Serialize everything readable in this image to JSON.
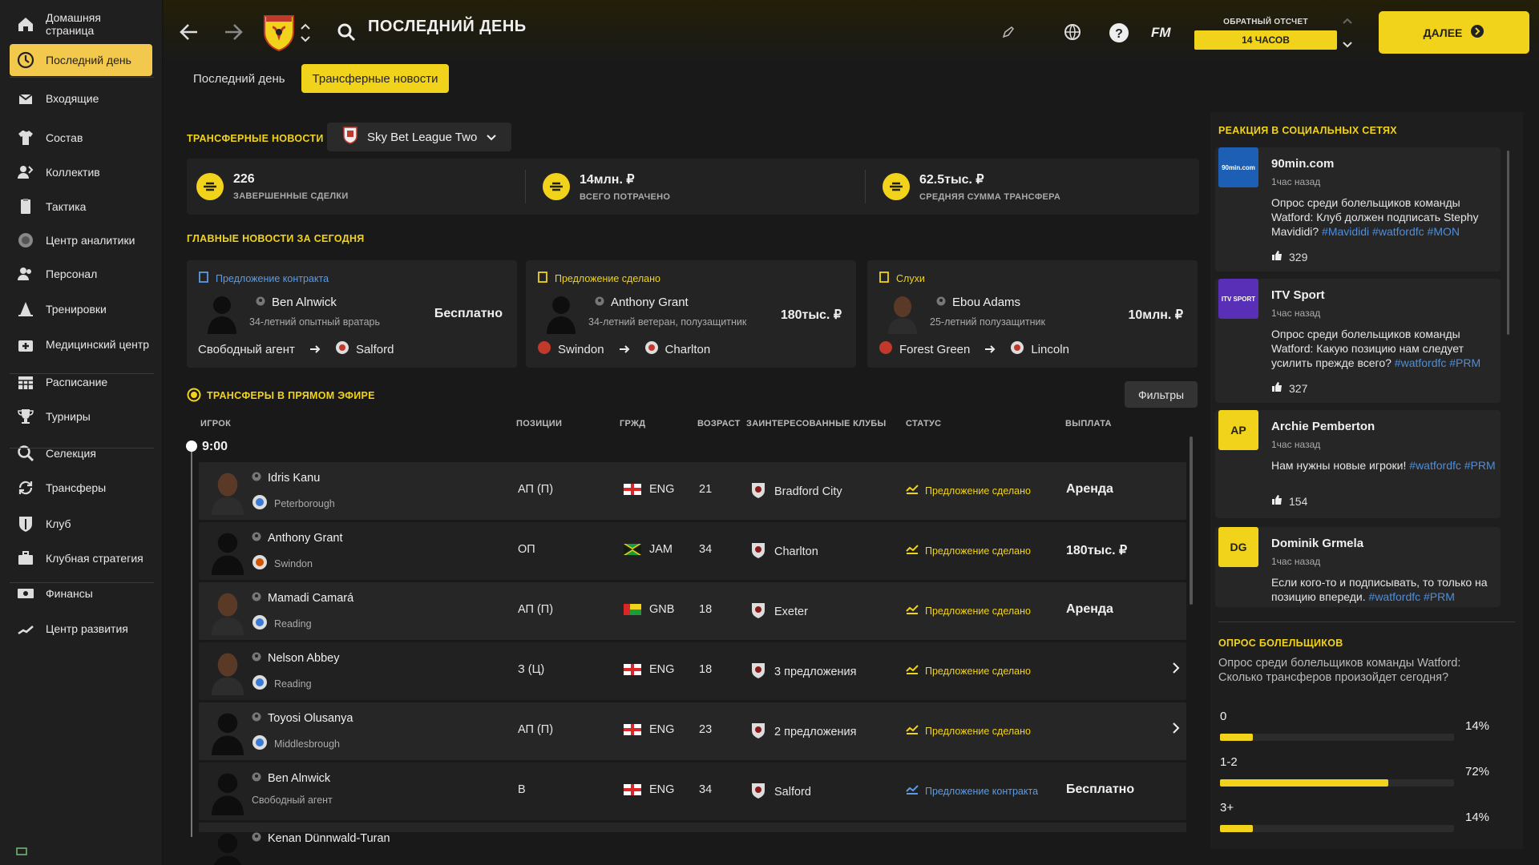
{
  "colors": {
    "accent": "#f2d31b",
    "sidebar_active": "#f2c94c",
    "link_blue": "#4a8fe0",
    "background": "#191919"
  },
  "sidebar": {
    "items": [
      {
        "label": "Домашняя страница",
        "icon": "home-icon"
      },
      {
        "label": "Последний день",
        "icon": "clock-icon",
        "active": true
      },
      {
        "label": "Входящие",
        "icon": "inbox-icon"
      },
      {
        "label": "Состав",
        "icon": "shirt-icon"
      },
      {
        "label": "Коллектив",
        "icon": "people-icon"
      },
      {
        "label": "Тактика",
        "icon": "tactics-board-icon"
      },
      {
        "label": "Центр аналитики",
        "icon": "analytics-icon"
      },
      {
        "label": "Персонал",
        "icon": "staff-icon"
      },
      {
        "label": "Тренировки",
        "icon": "cone-icon"
      },
      {
        "label": "Медицинский центр",
        "icon": "medical-kit-icon"
      },
      {
        "label": "Расписание",
        "icon": "calendar-icon"
      },
      {
        "label": "Турниры",
        "icon": "trophy-icon"
      },
      {
        "label": "Селекция",
        "icon": "magnifier-icon"
      },
      {
        "label": "Трансферы",
        "icon": "refresh-arrows-icon"
      },
      {
        "label": "Клуб",
        "icon": "shield-icon"
      },
      {
        "label": "Клубная стратегия",
        "icon": "briefcase-icon"
      },
      {
        "label": "Финансы",
        "icon": "money-icon"
      },
      {
        "label": "Центр развития",
        "icon": "growth-icon"
      }
    ]
  },
  "header": {
    "title": "ПОСЛЕДНИЙ ДЕНЬ",
    "club": "WATFORD",
    "fm_label": "FM",
    "countdown_label": "ОБРАТНЫЙ ОТСЧЕТ",
    "countdown_value": "14 ЧАСОВ",
    "next_label": "ДАЛЕЕ"
  },
  "tabs": [
    {
      "label": "Последний день"
    },
    {
      "label": "Трансферные новости",
      "active": true
    }
  ],
  "transfer_news": {
    "title": "ТРАНСФЕРНЫЕ НОВОСТИ",
    "league": "Sky Bet League Two"
  },
  "stats": [
    {
      "value": "226",
      "caption": "ЗАВЕРШЕННЫЕ СДЕЛКИ"
    },
    {
      "value": "14млн. ₽",
      "caption": "ВСЕГО ПОТРАЧЕНО"
    },
    {
      "value": "62.5тыс. ₽",
      "caption": "СРЕДНЯЯ СУММА ТРАНСФЕРА"
    }
  ],
  "top_news": {
    "title": "ГЛАВНЫЕ НОВОСТИ ЗА СЕГОДНЯ",
    "cards": [
      {
        "type": "Предложение контракта",
        "type_color": "#5b9be6",
        "name": "Ben Alnwick",
        "desc": "34-летний опытный вратарь",
        "fee": "Бесплатно",
        "from": "Свободный агент",
        "to": "Salford"
      },
      {
        "type": "Предложение сделано",
        "type_color": "#f2d31b",
        "name": "Anthony Grant",
        "desc": "34-летний ветеран, полузащитник",
        "fee": "180тыс. ₽",
        "from": "Swindon",
        "to": "Charlton"
      },
      {
        "type": "Слухи",
        "type_color": "#f2d31b",
        "name": "Ebou Adams",
        "desc": "25-летний полузащитник",
        "fee": "10млн. ₽",
        "from": "Forest Green",
        "to": "Lincoln"
      }
    ]
  },
  "live": {
    "title": "ТРАНСФЕРЫ В ПРЯМОМ ЭФИРЕ",
    "filters_label": "Фильтры",
    "time": "9:00",
    "columns": {
      "player": "ИГРОК",
      "position": "ПОЗИЦИИ",
      "nat": "ГРЖД",
      "age": "ВОЗРАСТ",
      "clubs": "ЗАИНТЕРЕСОВАННЫЕ КЛУБЫ",
      "status": "СТАТУС",
      "fee": "ВЫПЛАТА"
    },
    "rows": [
      {
        "name": "Idris Kanu",
        "club": "Peterborough",
        "position": "АП (П)",
        "nat": "ENG",
        "age": "21",
        "interested": "Bradford City",
        "status": "Предложение сделано",
        "fee": "Аренда"
      },
      {
        "name": "Anthony Grant",
        "club": "Swindon",
        "position": "ОП",
        "nat": "JAM",
        "age": "34",
        "interested": "Charlton",
        "status": "Предложение сделано",
        "fee": "180тыс. ₽"
      },
      {
        "name": "Mamadi Camará",
        "club": "Reading",
        "position": "АП (П)",
        "nat": "GNB",
        "age": "18",
        "interested": "Exeter",
        "status": "Предложение сделано",
        "fee": "Аренда"
      },
      {
        "name": "Nelson Abbey",
        "club": "Reading",
        "position": "З (Ц)",
        "nat": "ENG",
        "age": "18",
        "interested": "3 предложения",
        "status": "Предложение сделано",
        "fee": ""
      },
      {
        "name": "Toyosi Olusanya",
        "club": "Middlesbrough",
        "position": "АП (П)",
        "nat": "ENG",
        "age": "23",
        "interested": "2 предложения",
        "status": "Предложение сделано",
        "fee": ""
      },
      {
        "name": "Ben Alnwick",
        "club": "Свободный агент",
        "position": "В",
        "nat": "ENG",
        "age": "34",
        "interested": "Salford",
        "status": "Предложение контракта",
        "fee": "Бесплатно"
      },
      {
        "name": "Kenan Dünnwald-Turan",
        "club": "",
        "position": "",
        "nat": "",
        "age": "",
        "interested": "",
        "status": "",
        "fee": ""
      }
    ]
  },
  "social": {
    "title": "РЕАКЦИЯ В СОЦИАЛЬНЫХ СЕТЯХ",
    "posts": [
      {
        "avatar": "90min.com",
        "name": "90min.com",
        "time": "1час назад",
        "text": "Опрос среди болельщиков команды Watford: Клуб должен подписать Stephy Mavididi?",
        "tags": "#Mavididi #watfordfc #MON",
        "likes": "329"
      },
      {
        "avatar": "ITV SPORT",
        "name": "ITV Sport",
        "time": "1час назад",
        "text": "Опрос среди болельщиков команды Watford: Какую позицию нам следует усилить прежде всего?",
        "tags": "#watfordfc #PRM",
        "likes": "327"
      },
      {
        "avatar": "AP",
        "name": "Archie Pemberton",
        "time": "1час назад",
        "text": "Нам нужны новые игроки!",
        "tags": "#watfordfc #PRM",
        "likes": "154"
      },
      {
        "avatar": "DG",
        "name": "Dominik Grmela",
        "time": "1час назад",
        "text": "Если кого-то и подписывать, то только на позицию впереди.",
        "tags": "#watfordfc #PRM",
        "likes": ""
      }
    ]
  },
  "poll": {
    "title": "ОПРОС БОЛЕЛЬЩИКОВ",
    "question": "Опрос среди болельщиков команды Watford: Сколько трансферов произойдет сегодня?",
    "options": [
      {
        "label": "0",
        "pct": "14%",
        "value": 14
      },
      {
        "label": "1-2",
        "pct": "72%",
        "value": 72
      },
      {
        "label": "3+",
        "pct": "14%",
        "value": 14
      }
    ]
  }
}
